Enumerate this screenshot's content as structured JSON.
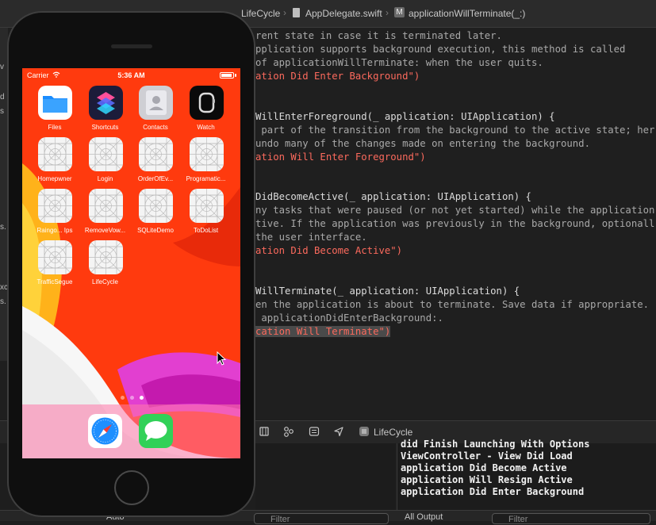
{
  "jumpbar": {
    "crumbs": [
      "LifeCycle",
      "AppDelegate.swift",
      "applicationWillTerminate(_:)"
    ],
    "method_icon": "M"
  },
  "code_lines": [
    {
      "text": "rent state in case it is terminated later.",
      "kind": "comment"
    },
    {
      "text": "pplication supports background execution, this method is called",
      "kind": "comment"
    },
    {
      "text": "of applicationWillTerminate: when the user quits.",
      "kind": "comment"
    },
    {
      "text": "ation Did Enter Background\")",
      "kind": "string"
    },
    {
      "text": "",
      "kind": "plain"
    },
    {
      "text": "",
      "kind": "plain"
    },
    {
      "text": "WillEnterForeground(_ application: UIApplication) {",
      "kind": "plain"
    },
    {
      "text": " part of the transition from the background to the active state; her",
      "kind": "comment"
    },
    {
      "text": "undo many of the changes made on entering the background.",
      "kind": "comment"
    },
    {
      "text": "ation Will Enter Foreground\")",
      "kind": "string"
    },
    {
      "text": "",
      "kind": "plain"
    },
    {
      "text": "",
      "kind": "plain"
    },
    {
      "text": "DidBecomeActive(_ application: UIApplication) {",
      "kind": "plain"
    },
    {
      "text": "ny tasks that were paused (or not yet started) while the application",
      "kind": "comment"
    },
    {
      "text": "tive. If the application was previously in the background, optionall",
      "kind": "comment"
    },
    {
      "text": "the user interface.",
      "kind": "comment"
    },
    {
      "text": "ation Did Become Active\")",
      "kind": "string"
    },
    {
      "text": "",
      "kind": "plain"
    },
    {
      "text": "",
      "kind": "plain"
    },
    {
      "text": "WillTerminate(_ application: UIApplication) {",
      "kind": "plain"
    },
    {
      "text": "en the application is about to terminate. Save data if appropriate. ",
      "kind": "comment"
    },
    {
      "text": " applicationDidEnterBackground:.",
      "kind": "comment"
    },
    {
      "text": "cation Will Terminate\")",
      "kind": "string-highlight"
    }
  ],
  "debug": {
    "scheme_label": "LifeCycle"
  },
  "console": {
    "lines": [
      "did Finish Launching With Options",
      "ViewController - View Did Load",
      "application Did Become Active",
      "application Will Resign Active",
      "application Did Enter Background"
    ]
  },
  "bottom": {
    "auto_label": "Auto",
    "filter_placeholder": "Filter",
    "output_label": "All Output",
    "filter_placeholder_right": "Filter"
  },
  "simulator": {
    "status": {
      "carrier": "Carrier",
      "time": "5:36 AM"
    },
    "apps": [
      {
        "label": "Files",
        "icon": "files-icon"
      },
      {
        "label": "Shortcuts",
        "icon": "shortcuts-icon"
      },
      {
        "label": "Contacts",
        "icon": "contacts-icon"
      },
      {
        "label": "Watch",
        "icon": "watch-icon"
      },
      {
        "label": "Homepwner",
        "icon": "placeholder-app-icon"
      },
      {
        "label": "Login",
        "icon": "placeholder-app-icon"
      },
      {
        "label": "OrderOfEv...",
        "icon": "placeholder-app-icon"
      },
      {
        "label": "Programatic...",
        "icon": "placeholder-app-icon"
      },
      {
        "label": "Raingo... Ips",
        "icon": "placeholder-app-icon"
      },
      {
        "label": "RemoveVow...",
        "icon": "placeholder-app-icon"
      },
      {
        "label": "SQLiteDemo",
        "icon": "placeholder-app-icon"
      },
      {
        "label": "ToDoList",
        "icon": "placeholder-app-icon"
      },
      {
        "label": "TrafficSegue",
        "icon": "placeholder-app-icon"
      },
      {
        "label": "LifeCycle",
        "icon": "placeholder-app-icon"
      }
    ],
    "dock": [
      {
        "icon": "safari-icon"
      },
      {
        "icon": "messages-icon"
      }
    ]
  },
  "colors": {
    "wallpaper": "#ff3a0e",
    "code_string": "#fc6a5d",
    "code_comment": "#a9a9a9"
  }
}
